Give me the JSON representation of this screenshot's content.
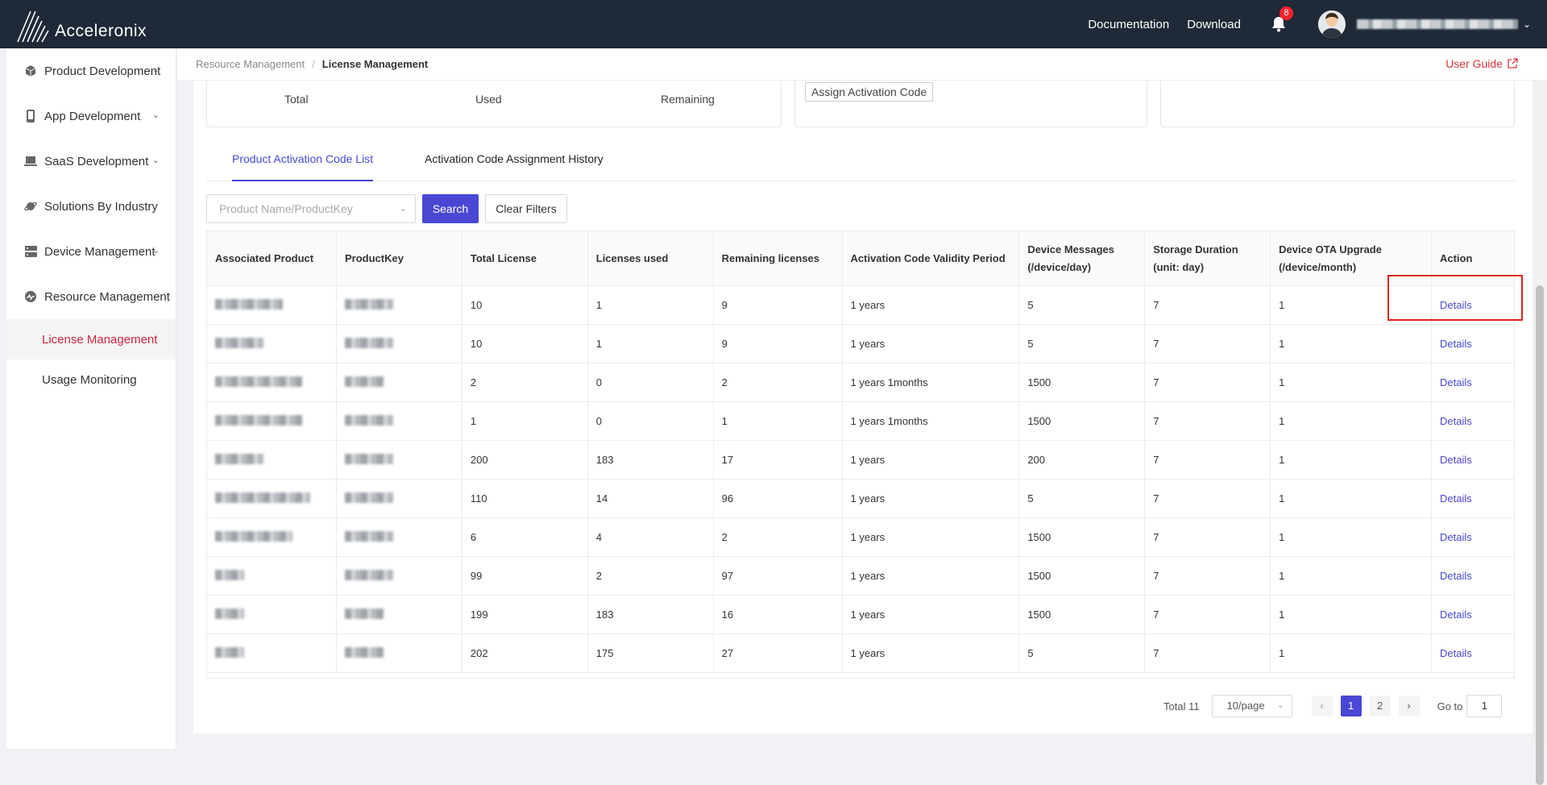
{
  "topbar": {
    "logo_text": "Acceleronix",
    "links": [
      "Documentation",
      "Download"
    ],
    "notification_count": "8",
    "user_caret": "⌄"
  },
  "sidebar": {
    "items": [
      {
        "label": "Product Development",
        "icon": "cube-icon"
      },
      {
        "label": "App Development",
        "icon": "phone-icon"
      },
      {
        "label": "SaaS Development",
        "icon": "laptop-icon"
      },
      {
        "label": "Solutions By Industry",
        "icon": "planet-icon"
      },
      {
        "label": "Device Management",
        "icon": "server-icon"
      },
      {
        "label": "Resource Management",
        "icon": "dashboard-icon"
      }
    ],
    "subitems": [
      {
        "label": "License Management",
        "active": true
      },
      {
        "label": "Usage Monitoring",
        "active": false
      }
    ]
  },
  "breadcrumb": {
    "parent": "Resource Management",
    "separator": "/",
    "current": "License Management",
    "user_guide": "User Guide"
  },
  "stats": {
    "total_label": "Total",
    "used_label": "Used",
    "remaining_label": "Remaining",
    "assign_button": "Assign Activation Code"
  },
  "tabs": [
    "Product Activation Code List",
    "Activation Code Assignment History"
  ],
  "filters": {
    "product_placeholder": "Product Name/ProductKey",
    "search_button": "Search",
    "clear_button": "Clear Filters"
  },
  "table": {
    "columns": [
      "Associated Product",
      "ProductKey",
      "Total License",
      "Licenses used",
      "Remaining licenses",
      "Activation Code Validity Period",
      "Device Messages (/device/day)",
      "Storage Duration (unit: day)",
      "Device OTA Upgrade (/device/month)",
      "Action"
    ],
    "rows": [
      {
        "total": "10",
        "used": "1",
        "remaining": "9",
        "validity": "1 years",
        "messages": "5",
        "storage": "7",
        "ota": "1",
        "action": "Details"
      },
      {
        "total": "10",
        "used": "1",
        "remaining": "9",
        "validity": "1 years",
        "messages": "5",
        "storage": "7",
        "ota": "1",
        "action": "Details"
      },
      {
        "total": "2",
        "used": "0",
        "remaining": "2",
        "validity": "1 years 1months",
        "messages": "1500",
        "storage": "7",
        "ota": "1",
        "action": "Details"
      },
      {
        "total": "1",
        "used": "0",
        "remaining": "1",
        "validity": "1 years 1months",
        "messages": "1500",
        "storage": "7",
        "ota": "1",
        "action": "Details"
      },
      {
        "total": "200",
        "used": "183",
        "remaining": "17",
        "validity": "1 years",
        "messages": "200",
        "storage": "7",
        "ota": "1",
        "action": "Details"
      },
      {
        "total": "110",
        "used": "14",
        "remaining": "96",
        "validity": "1 years",
        "messages": "5",
        "storage": "7",
        "ota": "1",
        "action": "Details"
      },
      {
        "total": "6",
        "used": "4",
        "remaining": "2",
        "validity": "1 years",
        "messages": "1500",
        "storage": "7",
        "ota": "1",
        "action": "Details"
      },
      {
        "total": "99",
        "used": "2",
        "remaining": "97",
        "validity": "1 years",
        "messages": "1500",
        "storage": "7",
        "ota": "1",
        "action": "Details"
      },
      {
        "total": "199",
        "used": "183",
        "remaining": "16",
        "validity": "1 years",
        "messages": "1500",
        "storage": "7",
        "ota": "1",
        "action": "Details"
      },
      {
        "total": "202",
        "used": "175",
        "remaining": "27",
        "validity": "1 years",
        "messages": "5",
        "storage": "7",
        "ota": "1",
        "action": "Details"
      }
    ]
  },
  "pagination": {
    "total": "Total 11",
    "page_size": "10/page",
    "pages": [
      "1",
      "2"
    ],
    "current_page": "1",
    "goto_label": "Go to",
    "goto_value": "1"
  },
  "colors": {
    "topbar": "#1f2937",
    "accent": "#4a47d4",
    "active_nav": "#c8283b",
    "highlight": "#e02020"
  }
}
